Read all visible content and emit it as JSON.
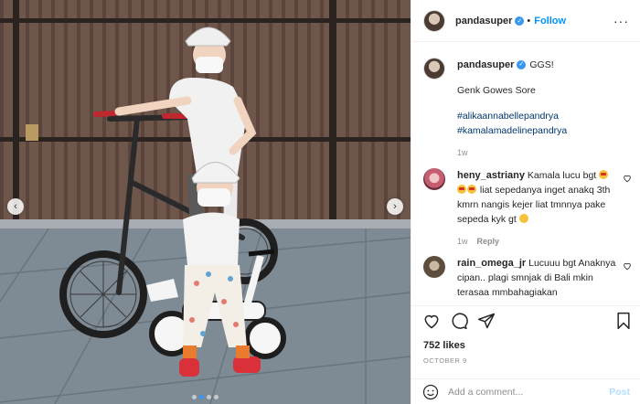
{
  "header": {
    "username": "pandasuper",
    "separator": "•",
    "follow_label": "Follow",
    "more_label": "···"
  },
  "caption": {
    "username": "pandasuper",
    "lines": [
      "GGS!",
      "Genk Gowes Sore"
    ],
    "hashtags": [
      "#alikaannabellepandrya",
      "#kamalamadelinepandrya"
    ],
    "time": "1w"
  },
  "comments": [
    {
      "username": "heny_astriany",
      "text_1": "Kamala lucu bgt",
      "text_2": "liat sepedanya inget anakq 3th kmrn nangis kejer liat tmnnya pake sepeda kyk gt",
      "time": "1w",
      "reply_label": "Reply"
    },
    {
      "username": "rain_omega_jr",
      "text": "Lucuuu bgt Anaknya cipan.. plagi smnjak di Bali mkin terasaa mmbahagiakan"
    }
  ],
  "likes": "752 likes",
  "date": "OCTOBER 9",
  "add_comment": {
    "placeholder": "Add a comment...",
    "post_label": "Post"
  },
  "photo": {
    "prev_label": "‹",
    "next_label": "›"
  },
  "colors": {
    "accent": "#0095f6",
    "verified": "#3897f0",
    "hashtag": "#00376b",
    "muted": "#8e8e8e"
  }
}
